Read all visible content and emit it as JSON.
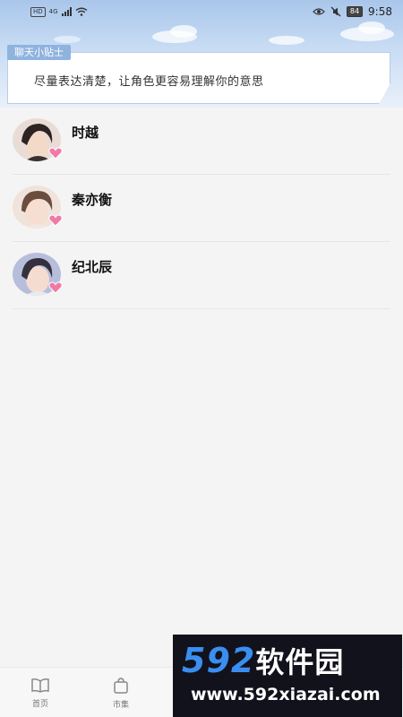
{
  "status_bar": {
    "network_badge": "HD",
    "signal_label": "4G",
    "battery": "84",
    "time": "9:58",
    "icons": [
      "signal-icon",
      "wifi-icon",
      "eye-icon",
      "mute-icon",
      "battery-icon"
    ]
  },
  "tips": {
    "tag": "聊天小贴士",
    "text": "尽量表达清楚，让角色更容易理解你的意思"
  },
  "contacts": [
    {
      "name": "时越",
      "avatar": "avatar-portrait",
      "badge": "heart-icon"
    },
    {
      "name": "秦亦衡",
      "avatar": "avatar-portrait",
      "badge": "heart-icon"
    },
    {
      "name": "纪北辰",
      "avatar": "avatar-portrait",
      "badge": "heart-icon"
    }
  ],
  "bottom_nav": [
    {
      "label": "首页",
      "icon": "book-icon"
    },
    {
      "label": "市集",
      "icon": "bag-icon"
    },
    {
      "label": "",
      "icon": ""
    },
    {
      "label": "",
      "icon": ""
    },
    {
      "label": "",
      "icon": ""
    }
  ],
  "watermark": {
    "logo_number": "592",
    "logo_text": "软件园",
    "url": "www.592xiazai.com"
  },
  "colors": {
    "accent_blue": "#8fb3df",
    "heart_pink": "#f07aa6",
    "watermark_blue": "#3a8ef0",
    "watermark_bg": "#12121c"
  }
}
